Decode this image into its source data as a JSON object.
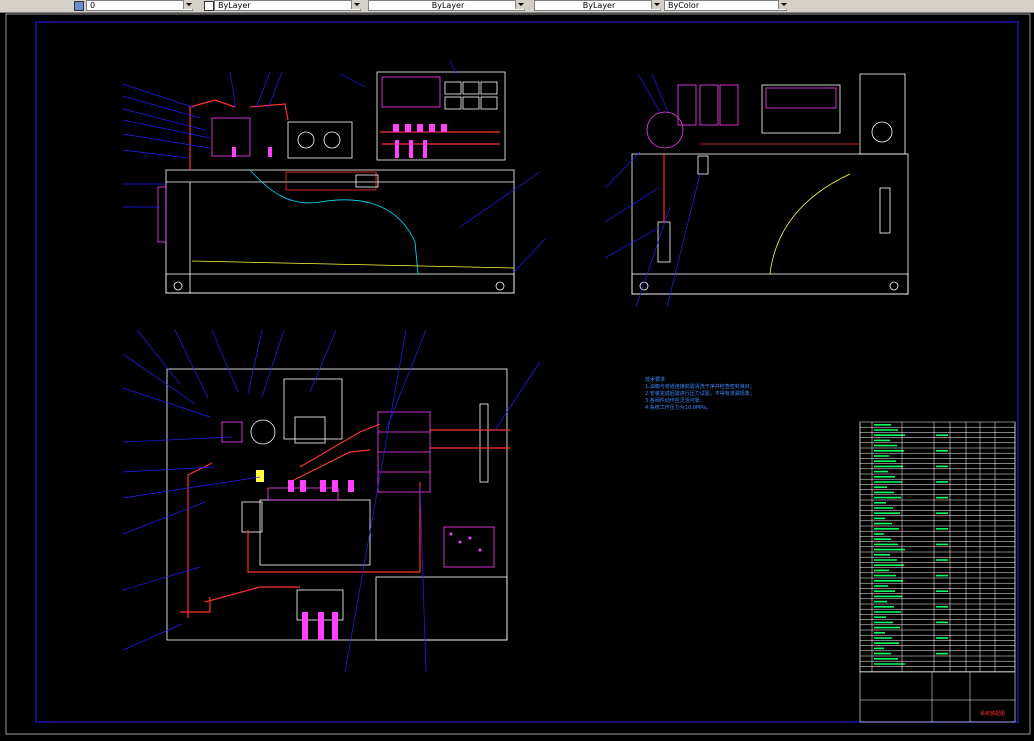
{
  "toolbar": {
    "layer_combo": "0",
    "color_combo": "ByLayer",
    "linetype_combo": "ByLayer",
    "lineweight_combo": "ByLayer",
    "plotstyle_combo": "ByColor"
  },
  "notes": {
    "title": "技术要求",
    "lines": [
      "1.油箱与管道连接前需清洗干净并检查密封良好；",
      "2.安装完成后需进行压力试验，不得有渗漏现象；",
      "3.各阀件动作应灵活可靠；",
      "4.系统工作压力为10.0MPa。"
    ]
  },
  "title_block": {
    "drawing_name": "系统装配图"
  },
  "colors": {
    "background": "#000000",
    "frame": "#2020ff",
    "outline": "#ffffff",
    "pipe": "#ff3030",
    "fitting": "#ff40ff",
    "leader": "#2020ff",
    "table_text": "#00ff60",
    "curve": "#ffff40"
  },
  "icons": {
    "layer_manager": "layer-manager-icon",
    "dropdown": "chevron-down-icon"
  }
}
